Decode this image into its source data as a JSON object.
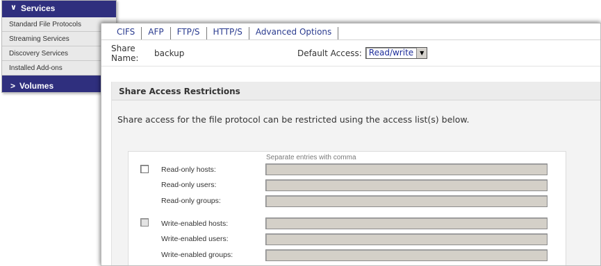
{
  "sidebar": {
    "header": "Services",
    "items": [
      "Standard File Protocols",
      "Streaming Services",
      "Discovery Services",
      "Installed Add-ons"
    ],
    "footer": "Volumes"
  },
  "tabs": [
    "CIFS",
    "AFP",
    "FTP/S",
    "HTTP/S",
    "Advanced Options"
  ],
  "share": {
    "name_label": "Share Name:",
    "name_value": "backup",
    "default_access_label": "Default Access:",
    "default_access_value": "Read/write"
  },
  "restrictions": {
    "title": "Share Access Restrictions",
    "description": "Share access for the file protocol can be restricted using the access list(s) below.",
    "hint": "Separate entries with comma",
    "read_only_hosts": "Read-only hosts:",
    "read_only_users": "Read-only users:",
    "read_only_groups": "Read-only groups:",
    "write_enabled_hosts": "Write-enabled hosts:",
    "write_enabled_users": "Write-enabled users:",
    "write_enabled_groups": "Write-enabled groups:"
  },
  "icons": {
    "header_chevron": "chevron-down-icon",
    "footer_chevron": "chevron-right-icon",
    "select_arrow": "dropdown-arrow-icon"
  },
  "colors": {
    "sidebar_header": "#2f2f7e",
    "tab_link": "#2a3b8f",
    "field_disabled": "#d4d0c8"
  }
}
